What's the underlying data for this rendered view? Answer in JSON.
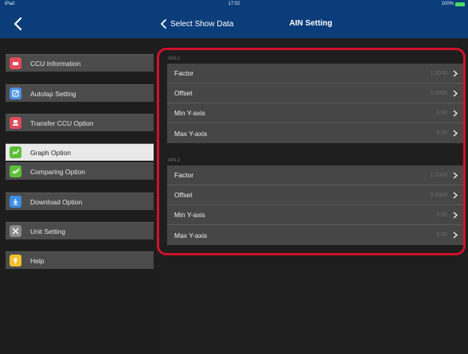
{
  "status_bar": {
    "carrier": "iPad",
    "time": "17:02",
    "battery": "100%"
  },
  "header": {
    "back_label": "Select Show Data",
    "title": "AIN Setting"
  },
  "sidebar": {
    "items": [
      {
        "label": "CCU Information",
        "icon": "ccu-info-icon",
        "color": "#e04a5a",
        "selected": false
      },
      {
        "label": "Autolap Setting",
        "icon": "autolap-icon",
        "color": "#4a90e2",
        "selected": false
      },
      {
        "label": "Transfer CCU Option",
        "icon": "transfer-icon",
        "color": "#e04a5a",
        "selected": false
      },
      {
        "label": "Graph Option",
        "icon": "graph-icon",
        "color": "#5cbf3a",
        "selected": true
      },
      {
        "label": "Comparing Option",
        "icon": "comparing-icon",
        "color": "#5cbf3a",
        "selected": false
      },
      {
        "label": "Download Option",
        "icon": "download-icon",
        "color": "#3a8ee6",
        "selected": false
      },
      {
        "label": "Unit Setting",
        "icon": "unit-icon",
        "color": "#8a8a8a",
        "selected": false
      },
      {
        "label": "Help",
        "icon": "help-icon",
        "color": "#f0c030",
        "selected": false
      }
    ]
  },
  "content": {
    "sections": [
      {
        "header": "AIN-1",
        "rows": [
          {
            "label": "Factor",
            "value": "1.0000"
          },
          {
            "label": "Offset",
            "value": "0.0000"
          },
          {
            "label": "Min Y-axis",
            "value": "0.00"
          },
          {
            "label": "Max Y-axis",
            "value": "5.00"
          }
        ]
      },
      {
        "header": "AIN-2",
        "rows": [
          {
            "label": "Factor",
            "value": "1.0000"
          },
          {
            "label": "Offset",
            "value": "0.0000"
          },
          {
            "label": "Min Y-axis",
            "value": "0.00"
          },
          {
            "label": "Max Y-axis",
            "value": "5.00"
          }
        ]
      }
    ]
  },
  "colors": {
    "nav_bar": "#0b3d7a",
    "highlight": "#d0122a",
    "selected_bg": "#e9e9e9"
  }
}
